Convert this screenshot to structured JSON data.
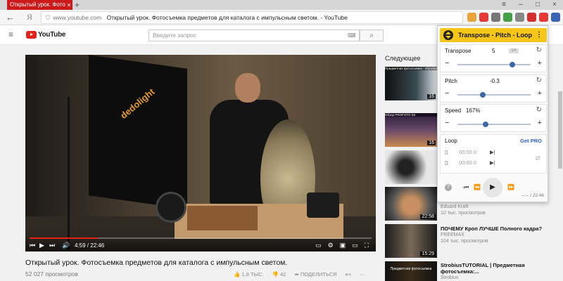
{
  "browser": {
    "tab_title": "Открытый урок. Фотосъ",
    "tab_close": "×",
    "tab_new": "+",
    "win_controls": [
      "≡",
      "–",
      "□",
      "×"
    ],
    "back": "←",
    "logo": "Я",
    "url_host": "www.youtube.com",
    "url_title": "Открытый урок. Фотосъемка предметов для каталога с импульсным светом. - YouTube",
    "ext_colors": [
      "#e8a33a",
      "#e53935",
      "#777777",
      "#43a047",
      "#888888",
      "#d32f2f",
      "#e53935",
      "#3b63b5"
    ]
  },
  "youtube": {
    "menu_icon": "≡",
    "logo_text": "YouTube",
    "search_placeholder": "Введите запрос",
    "search_btn": "⌕",
    "keyboard_icon": "⌨"
  },
  "video": {
    "brand_text": "dedolight",
    "progress": 0.2,
    "time": "4:59 / 22:46",
    "title": "Открытый урок. Фотосъемка предметов для каталога с импульсным светом.",
    "views": "52 027 просмотров",
    "likes": "1,8 ТЫС.",
    "dislikes": "42",
    "share": "ПОДЕЛИТЬСЯ",
    "add": "≡+",
    "more": "⋯"
  },
  "sidebar": {
    "next_label": "Следующее",
    "items": [
      {
        "duration": "16",
        "caption": "Предметная фотосъемка - обучение",
        "title": "",
        "channel": "",
        "views": ""
      },
      {
        "duration": "16",
        "caption": "Обзор PROFOTO D2",
        "title": "",
        "channel": "",
        "views": ""
      },
      {
        "duration": "",
        "caption": "",
        "title": "",
        "channel": "",
        "views": ""
      },
      {
        "duration": "",
        "caption": "",
        "title": "",
        "channel": "",
        "views": ""
      },
      {
        "duration": "22:58",
        "caption": "",
        "title": "",
        "channel": "Eduard Kraft",
        "views": "10 тыс. просмотров"
      },
      {
        "duration": "15:29",
        "caption": "",
        "title": "ПОЧЕМУ Кроп ЛУЧШЕ Полного кадра?",
        "channel": "FREEMAX",
        "views": "104 тыс. просмотров"
      },
      {
        "duration": "",
        "caption": "Предметная фотосъемка",
        "title": "StrobiusTUTORIAL | Предметная фотосъемка:...",
        "channel": "Strobius",
        "views": ""
      }
    ]
  },
  "extension": {
    "title": "Transpose - Pitch - Loop",
    "menu": "⋮",
    "transpose": {
      "label": "Transpose",
      "value": "5",
      "badge": "1/4",
      "level": 0.75
    },
    "pitch": {
      "label": "Pitch",
      "value": "-0.3",
      "level": 0.35
    },
    "speed": {
      "label": "Speed",
      "value": "167%",
      "level": 0.38
    },
    "loop": {
      "label": "Loop",
      "get_pro": "Get PRO",
      "a_time": "00:00.0",
      "b_time": "00:00.0"
    },
    "reset_icon": "↻",
    "minus": "−",
    "plus": "+",
    "help": "?",
    "prev": "⏮",
    "rew": "⏪",
    "play": "▶",
    "ff": "⏩",
    "time": "--:-- / 22:46"
  }
}
